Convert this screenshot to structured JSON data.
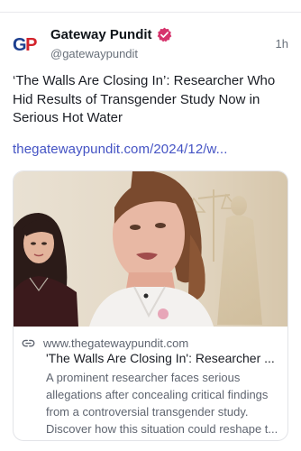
{
  "author": {
    "avatar_text": "GP",
    "display_name": "Gateway Pundit",
    "handle": "@gatewaypundit",
    "verified": true,
    "time": "1h"
  },
  "post": {
    "text": "‘The Walls Are Closing In’: Researcher Who Hid Results of Transgender Study Now in Serious Hot Water",
    "link": "thegatewaypundit.com/2024/12/w..."
  },
  "card": {
    "domain": "www.thegatewaypundit.com",
    "title": "'The Walls Are Closing In': Researcher ...",
    "description": "A prominent researcher faces serious allegations after concealing critical findings from a controversial transgender study. Discover how this situation could reshape t..."
  },
  "colors": {
    "link": "#4453c4",
    "verified_badge": "#d6336c",
    "logo_g": "#1c3f8f",
    "logo_p": "#d3242c"
  },
  "icons": {
    "verified": "verified-badge-icon",
    "link": "link-chain-icon"
  }
}
